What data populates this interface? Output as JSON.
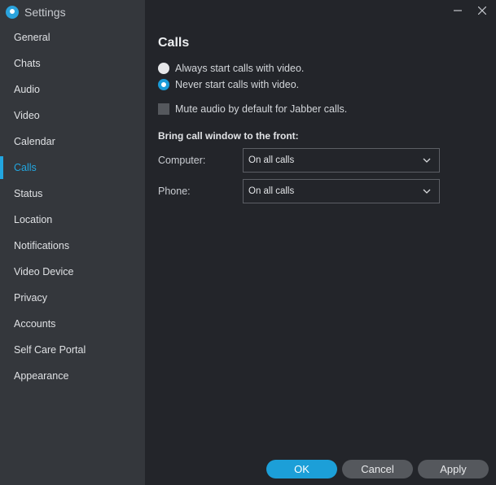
{
  "window": {
    "title": "Settings",
    "icon": "jabber-app-icon"
  },
  "controls": {
    "minimize": "–",
    "close": "✕"
  },
  "sidebar": {
    "items": [
      {
        "label": "General"
      },
      {
        "label": "Chats"
      },
      {
        "label": "Audio"
      },
      {
        "label": "Video"
      },
      {
        "label": "Calendar"
      },
      {
        "label": "Calls",
        "active": true
      },
      {
        "label": "Status"
      },
      {
        "label": "Location"
      },
      {
        "label": "Notifications"
      },
      {
        "label": "Video Device"
      },
      {
        "label": "Privacy"
      },
      {
        "label": "Accounts"
      },
      {
        "label": "Self Care Portal"
      },
      {
        "label": "Appearance"
      }
    ]
  },
  "calls": {
    "heading": "Calls",
    "radio_always": {
      "label": "Always start calls with video.",
      "checked": false
    },
    "radio_never": {
      "label": "Never start calls with video.",
      "checked": true
    },
    "mute_checkbox": {
      "label": "Mute audio by default for Jabber calls.",
      "checked": false
    },
    "bring_front_label": "Bring call window to the front:",
    "computer": {
      "label": "Computer:",
      "value": "On all calls"
    },
    "phone": {
      "label": "Phone:",
      "value": "On all calls"
    }
  },
  "footer": {
    "ok": "OK",
    "cancel": "Cancel",
    "apply": "Apply"
  },
  "colors": {
    "accent": "#1c9fd8",
    "sidebar_bg": "#34373c",
    "content_bg": "#23252a"
  }
}
